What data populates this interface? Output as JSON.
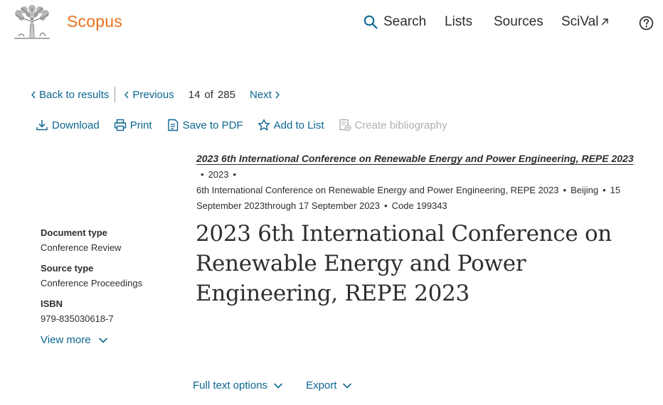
{
  "header": {
    "brand": "Scopus",
    "nav": {
      "search": "Search",
      "lists": "Lists",
      "sources": "Sources",
      "scival": "SciVal"
    },
    "accent_color": "#e9711c",
    "link_color": "#0b6690"
  },
  "result_nav": {
    "back": "Back to results",
    "previous": "Previous",
    "current": "14",
    "of": "of",
    "total": "285",
    "next": "Next"
  },
  "toolbar": {
    "download": "Download",
    "print": "Print",
    "save_pdf": "Save to PDF",
    "add_list": "Add to List",
    "bibliography": "Create bibliography"
  },
  "source": {
    "title": "2023 6th International Conference on Renewable Energy and Power Engineering, REPE 2023",
    "year": "2023",
    "conference": "6th International Conference on Renewable Energy and Power Engineering, REPE 2023",
    "location": "Beijing",
    "dates": "15 September 2023through 17 September 2023",
    "code": "Code 199343"
  },
  "metadata": {
    "doc_type_label": "Document type",
    "doc_type_value": "Conference Review",
    "source_type_label": "Source type",
    "source_type_value": "Conference Proceedings",
    "isbn_label": "ISBN",
    "isbn_value": "979-835030618-7",
    "view_more": "View more"
  },
  "document": {
    "title": "2023 6th International Conference on Renewable Energy and Power Engineering, REPE 2023"
  },
  "actions": {
    "full_text": "Full text options",
    "export": "Export"
  }
}
